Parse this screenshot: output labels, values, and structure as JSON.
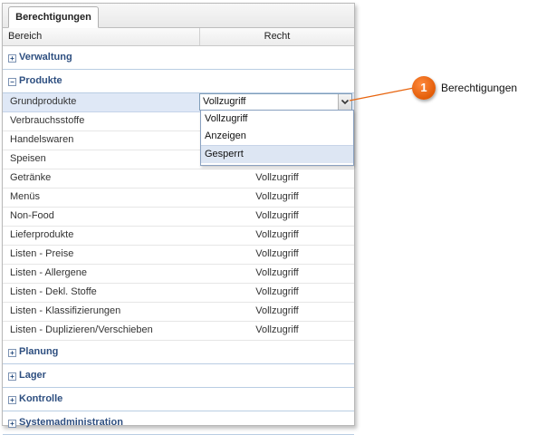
{
  "tab": {
    "label": "Berechtigungen"
  },
  "columns": {
    "area": "Bereich",
    "right": "Recht"
  },
  "groups_top": [
    {
      "label": "Verwaltung",
      "toggle": "+"
    }
  ],
  "produkte": {
    "label": "Produkte",
    "toggle": "−",
    "rows": [
      {
        "label": "Grundprodukte",
        "value": "Vollzugriff"
      },
      {
        "label": "Verbrauchsstoffe",
        "value": ""
      },
      {
        "label": "Handelswaren",
        "value": ""
      },
      {
        "label": "Speisen",
        "value": ""
      },
      {
        "label": "Getränke",
        "value": "Vollzugriff"
      },
      {
        "label": "Menüs",
        "value": "Vollzugriff"
      },
      {
        "label": "Non-Food",
        "value": "Vollzugriff"
      },
      {
        "label": "Lieferprodukte",
        "value": "Vollzugriff"
      },
      {
        "label": "Listen - Preise",
        "value": "Vollzugriff"
      },
      {
        "label": "Listen - Allergene",
        "value": "Vollzugriff"
      },
      {
        "label": "Listen - Dekl. Stoffe",
        "value": "Vollzugriff"
      },
      {
        "label": "Listen - Klassifizierungen",
        "value": "Vollzugriff"
      },
      {
        "label": "Listen - Duplizieren/Verschieben",
        "value": "Vollzugriff"
      }
    ]
  },
  "groups_bottom": [
    {
      "label": "Planung",
      "toggle": "+"
    },
    {
      "label": "Lager",
      "toggle": "+"
    },
    {
      "label": "Kontrolle",
      "toggle": "+"
    },
    {
      "label": "Systemadministration",
      "toggle": "+"
    }
  ],
  "dropdown": {
    "selected": "Vollzugriff",
    "options": [
      "Vollzugriff",
      "Anzeigen",
      "Gesperrt"
    ],
    "highlighted": "Gesperrt"
  },
  "callout": {
    "number": "1",
    "text": "Berechtigungen",
    "color": "#e8650f"
  }
}
